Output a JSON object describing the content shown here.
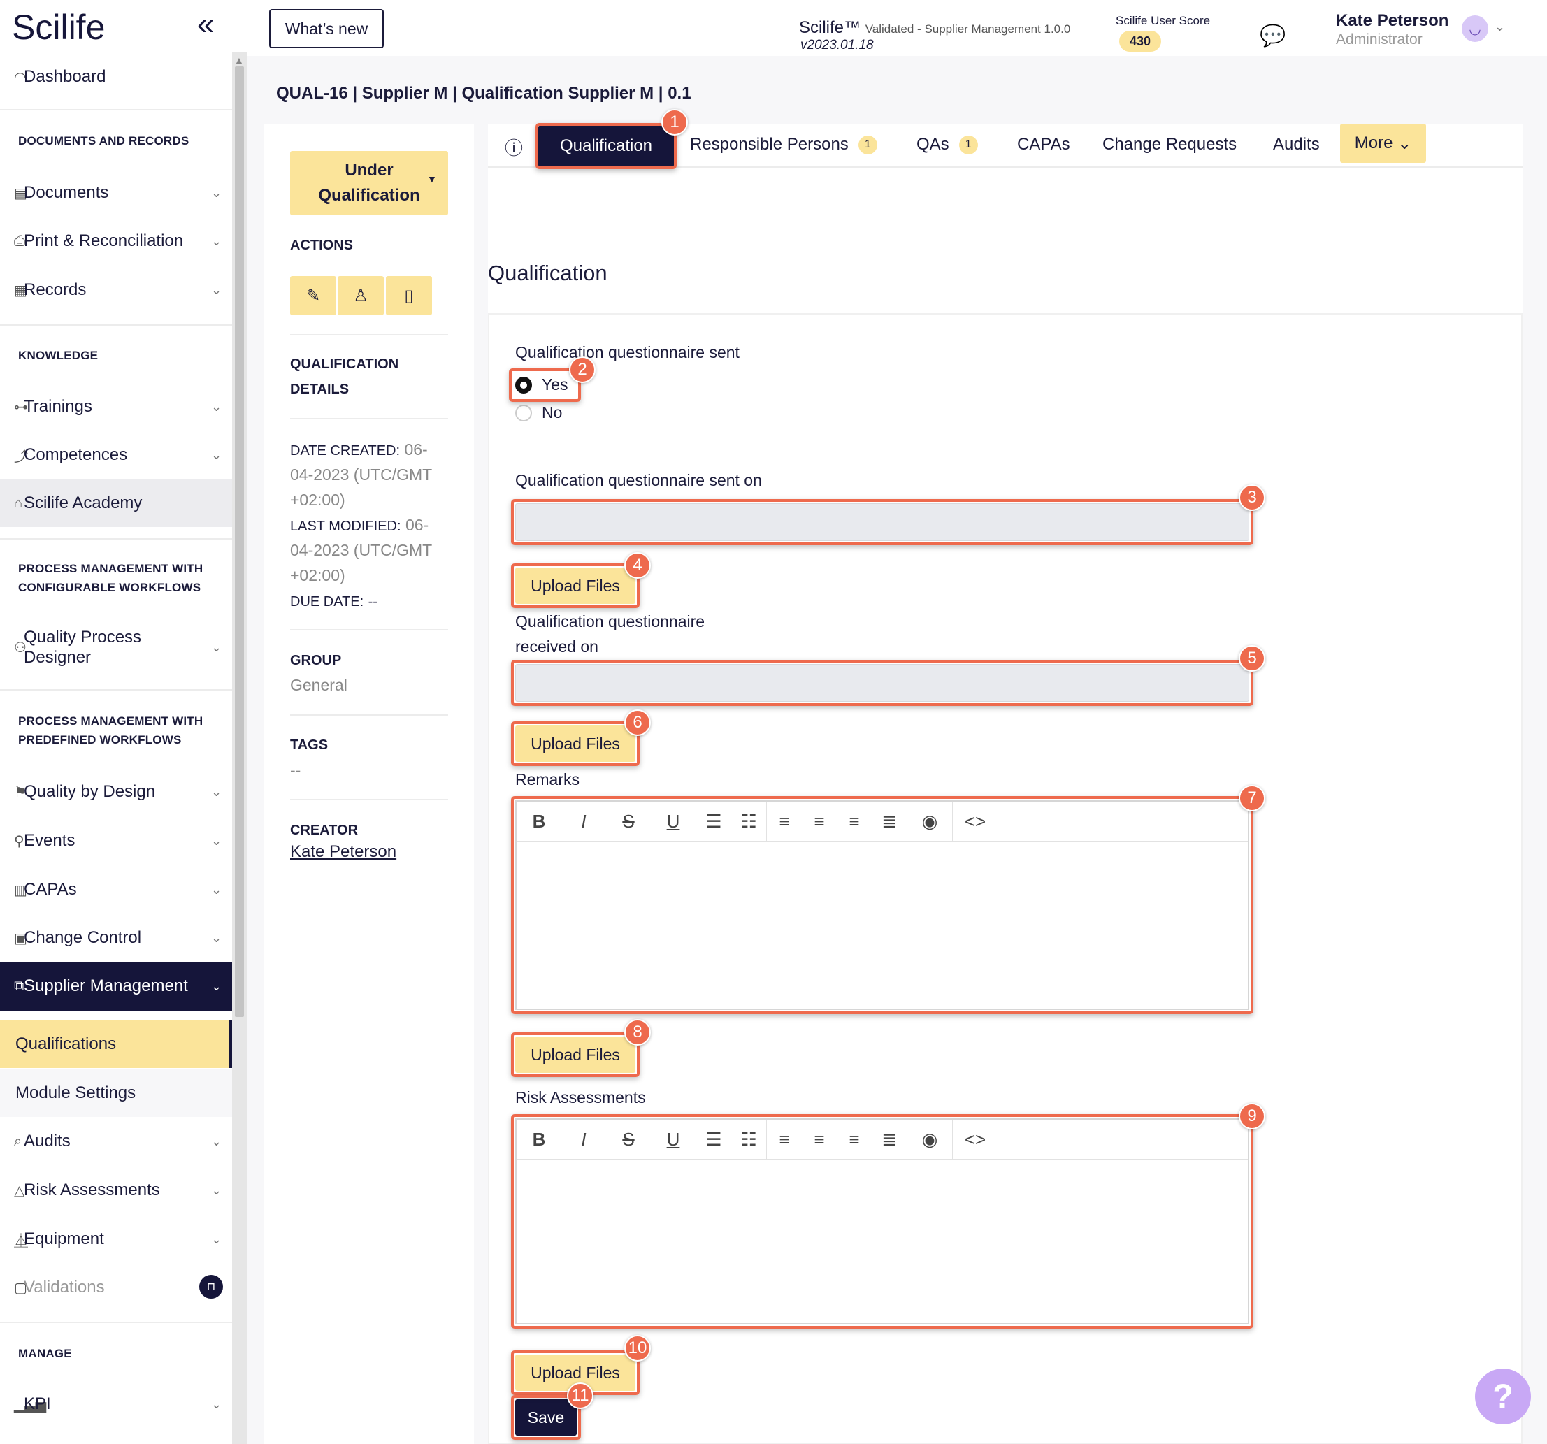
{
  "app": {
    "logo": "Scilife",
    "collapse_icon": "double-chevron-left-icon"
  },
  "topbar": {
    "whats_new": "What’s new",
    "app_name": "Scilife™",
    "app_module": "Validated - Supplier Management 1.0.0",
    "app_version": "v2023.01.18",
    "score_label": "Scilife User Score",
    "score_value": "430",
    "user_name": "Kate Peterson",
    "user_role": "Administrator"
  },
  "sidebar": {
    "dashboard": "Dashboard",
    "sections": {
      "docs": "DOCUMENTS AND RECORDS",
      "knowledge": "KNOWLEDGE",
      "config_wf_1": "PROCESS MANAGEMENT WITH",
      "config_wf_2": "CONFIGURABLE WORKFLOWS",
      "predef_wf_1": "PROCESS MANAGEMENT WITH",
      "predef_wf_2": "PREDEFINED WORKFLOWS",
      "manage": "MANAGE"
    },
    "items": {
      "documents": "Documents",
      "print": "Print & Reconciliation",
      "records": "Records",
      "trainings": "Trainings",
      "competences": "Competences",
      "academy": "Scilife Academy",
      "qpd_1": "Quality Process",
      "qpd_2": "Designer",
      "qbd": "Quality by Design",
      "events": "Events",
      "capas": "CAPAs",
      "change_control": "Change Control",
      "supplier_mgmt": "Supplier Management",
      "qualifications": "Qualifications",
      "module_settings": "Module Settings",
      "audits": "Audits",
      "risk": "Risk Assessments",
      "equipment": "Equipment",
      "validations": "Validations",
      "kpi": "KPI"
    }
  },
  "page": {
    "breadcrumb": "QUAL-16 | Supplier M | Qualification Supplier M | 0.1",
    "status_1": "Under",
    "status_2": "Qualification",
    "actions_label": "ACTIONS",
    "qual_details_1": "QUALIFICATION",
    "qual_details_2": "DETAILS",
    "date_created_label": "DATE CREATED:",
    "date_created_1": "06-",
    "date_created_2": "04-2023 (UTC/GMT",
    "date_created_3": "+02:00)",
    "last_modified_label": "LAST MODIFIED:",
    "last_modified_1": "06-",
    "last_modified_2": "04-2023 (UTC/GMT",
    "last_modified_3": "+02:00)",
    "due_date_label": "DUE DATE:",
    "due_date": "--",
    "group_label": "GROUP",
    "group_value": "General",
    "tags_label": "TAGS",
    "tags_value": "--",
    "creator_label": "CREATOR",
    "creator_value": "Kate Peterson"
  },
  "tabs": {
    "qualification": "Qualification",
    "responsible": "Responsible Persons",
    "responsible_count": "1",
    "qas": "QAs",
    "qas_count": "1",
    "capas": "CAPAs",
    "change_requests": "Change Requests",
    "audits": "Audits",
    "more": "More"
  },
  "form": {
    "title": "Qualification",
    "q_sent_label": "Qualification questionnaire sent",
    "yes": "Yes",
    "no": "No",
    "selected": "Yes",
    "sent_on_label": "Qualification questionnaire sent on",
    "received_on_label_1": "Qualification questionnaire",
    "received_on_label_2": "received on",
    "upload": "Upload Files",
    "remarks_label": "Remarks",
    "risk_label": "Risk Assessments",
    "save": "Save"
  },
  "markers": [
    "1",
    "2",
    "3",
    "4",
    "5",
    "6",
    "7",
    "8",
    "9",
    "10",
    "11"
  ],
  "colors": {
    "accent": "#fbe49a",
    "navy": "#15153a",
    "highlight": "#ee6a4d"
  }
}
